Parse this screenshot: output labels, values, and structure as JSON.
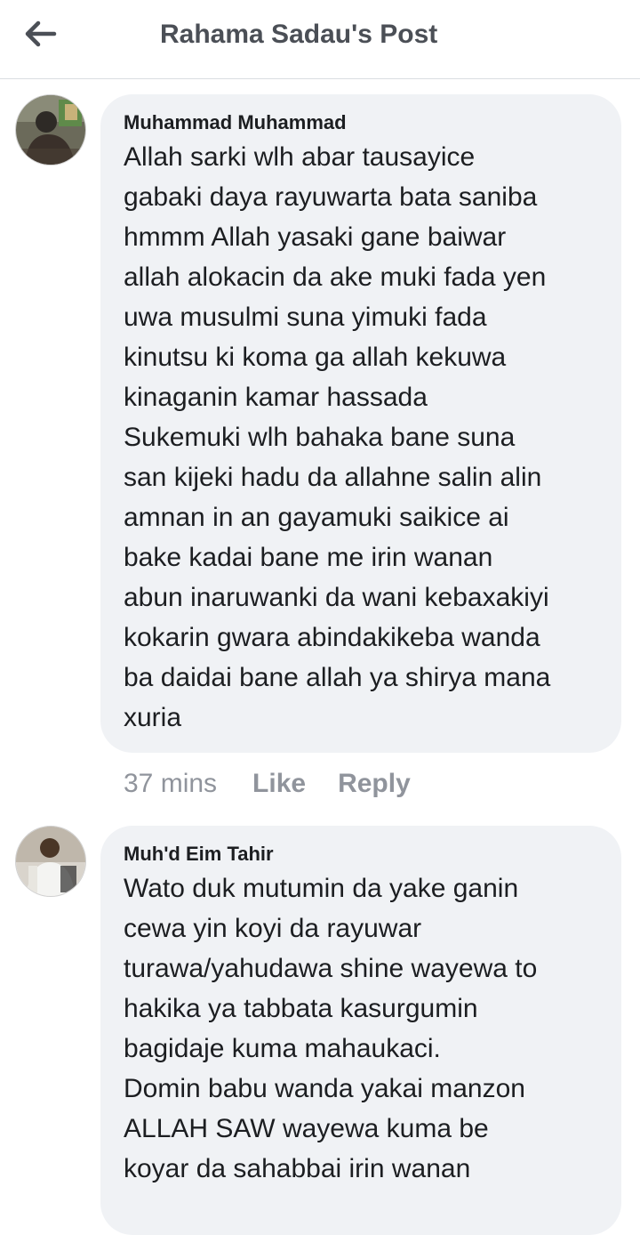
{
  "header": {
    "title": "Rahama Sadau's Post",
    "back_icon": "arrow-left-icon"
  },
  "comments": [
    {
      "author": "Muhammad Muhammad",
      "text": "Allah sarki wlh abar tausayice\ngabaki daya rayuwarta bata saniba\nhmmm Allah yasaki gane baiwar\nallah alokacin da ake muki fada yen\nuwa musulmi suna yimuki fada\nkinutsu ki koma ga allah kekuwa\nkinaganin kamar hassada\nSukemuki wlh bahaka bane suna\nsan kijeki hadu da allahne salin alin\namnan in an gayamuki saikice ai\nbake kadai bane me irin wanan\nabun inaruwanki da wani kebaxakiyi\nkokarin gwara abindakikeba wanda\nba daidai bane allah ya shirya mana\nxuria",
      "time": "37 mins",
      "like_label": "Like",
      "reply_label": "Reply"
    },
    {
      "author": "Muh'd Eim Tahir",
      "text": "Wato duk mutumin da yake ganin\ncewa yin koyi da rayuwar\nturawa/yahudawa shine wayewa to\nhakika ya tabbata kasurgumin\nbagidaje kuma mahaukaci.\nDomin babu wanda yakai manzon\nALLAH SAW wayewa kuma be\nkoyar da sahabbai irin wanan"
    }
  ],
  "colors": {
    "bubble_bg": "#f0f2f5",
    "meta_text": "#90949c",
    "title_text": "#4b4f56"
  }
}
